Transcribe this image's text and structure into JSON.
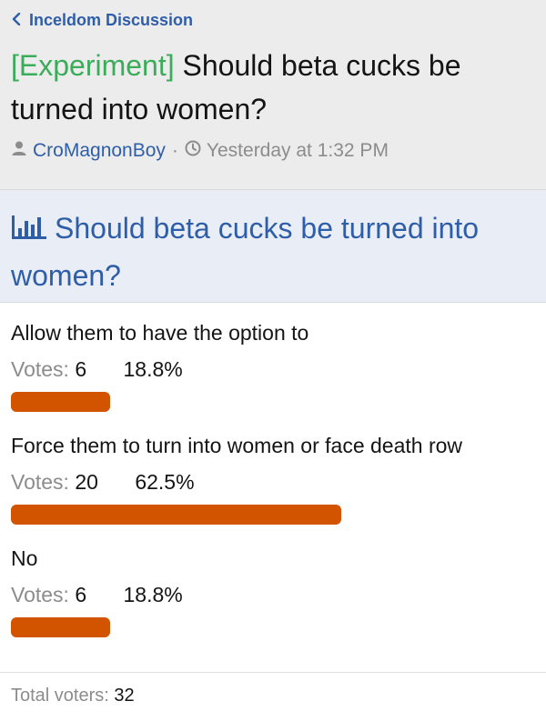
{
  "breadcrumb": {
    "label": "Inceldom Discussion"
  },
  "thread": {
    "prefix": "[Experiment]",
    "title": "Should beta cucks be turned into women?",
    "author": "CroMagnonBoy",
    "separator": "·",
    "timestamp": "Yesterday at 1:32 PM"
  },
  "poll": {
    "question": "Should beta cucks be turned into women?",
    "votes_label": "Votes:",
    "responses": [
      {
        "label": "Allow them to have the option to",
        "votes": "6",
        "percent": "18.8%",
        "fraction": 0.188
      },
      {
        "label": "Force them to turn into women or face death row",
        "votes": "20",
        "percent": "62.5%",
        "fraction": 0.625
      },
      {
        "label": "No",
        "votes": "6",
        "percent": "18.8%",
        "fraction": 0.188
      }
    ],
    "total_label": "Total voters:",
    "total": "32",
    "bar_color": "#d35400"
  },
  "colors": {
    "link": "#2f5ea8",
    "prefix": "#3bac5a",
    "muted": "#8c8c8c"
  },
  "icons": {
    "breadcrumb": "chevron-left-icon",
    "author": "user-icon",
    "time": "clock-icon",
    "poll": "bar-chart-icon"
  }
}
